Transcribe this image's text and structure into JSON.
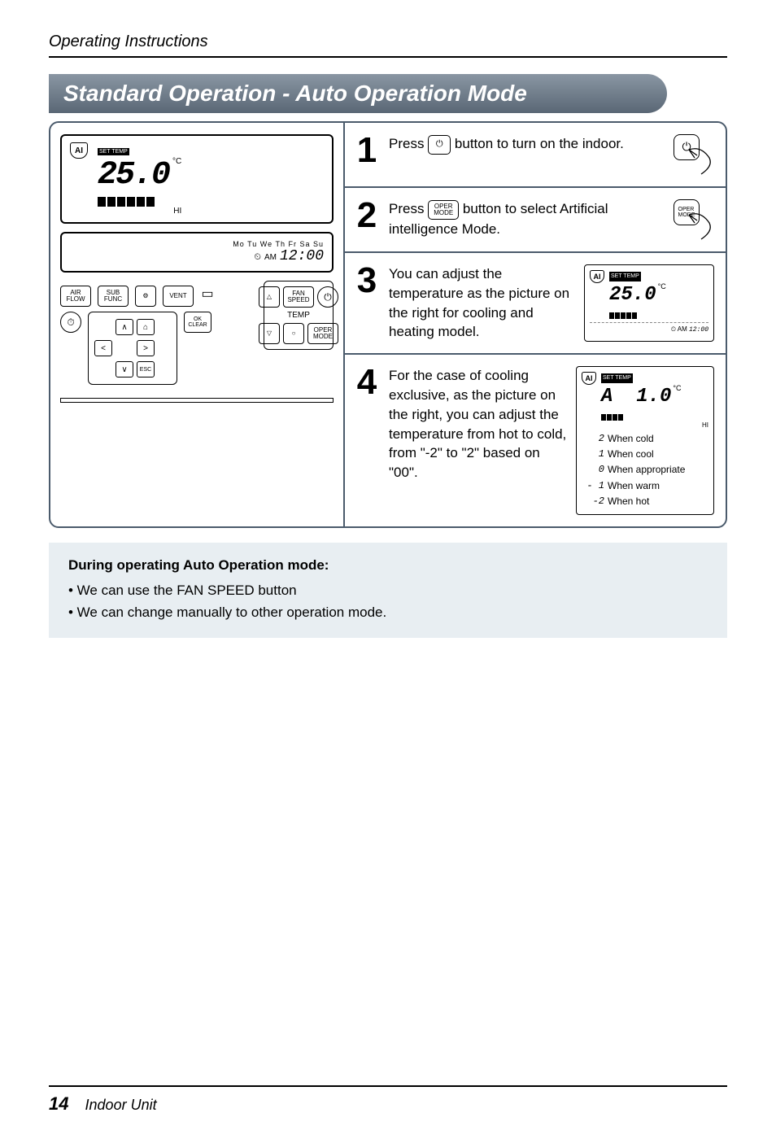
{
  "header": {
    "title": "Operating Instructions"
  },
  "section": {
    "title": "Standard Operation - Auto Operation Mode"
  },
  "remote": {
    "lcd1": {
      "set_temp_tag": "SET TEMP",
      "temp": "25.0",
      "unit": "°C",
      "ai": "AI",
      "hi": "HI"
    },
    "lcd2": {
      "days": "Mo Tu We Th Fr Sa Su",
      "am": "AM",
      "time": "12:00"
    },
    "buttons": {
      "air_flow": "AIR\nFLOW",
      "sub_func": "SUB\nFUNC",
      "settings": "⚙",
      "vent": "VENT",
      "timer": "⏱",
      "up": "∧",
      "home": "⌂",
      "ok_clear": "OK\nCLEAR",
      "left": "<",
      "right": ">",
      "down": "∨",
      "esc": "ESC",
      "tri_up": "△",
      "fan_speed": "FAN\nSPEED",
      "power": "⏻",
      "temp_lbl": "TEMP",
      "tri_down": "▽",
      "circle": "○",
      "oper_mode": "OPER\nMODE"
    }
  },
  "steps": [
    {
      "num": "1",
      "pre": "Press ",
      "btn_icon": "⏻",
      "post": " button to turn on the indoor.",
      "press_label": ""
    },
    {
      "num": "2",
      "pre": "Press ",
      "btn_text": "OPER\nMODE",
      "post": " button to select Artificial intelligence Mode.",
      "press_label": "OPER\nMODE"
    },
    {
      "num": "3",
      "text": "You can adjust the temperature as the picture on the right for cooling and heating model.",
      "mini": {
        "ai": "AI",
        "temp": "25.0",
        "unit": "°C",
        "time": "12:00",
        "am": "AM",
        "tag": "SET TEMP"
      }
    },
    {
      "num": "4",
      "text": "For the case of cooling exclusive, as the picture on the right, you can adjust the temperature from hot to cold, from \"-2\" to \"2\" based on \"00\".",
      "mini": {
        "ai": "AI",
        "disp": "A  1.0",
        "unit": "°C",
        "tag": "SET TEMP",
        "hi": "HI"
      },
      "legend": {
        "r1": {
          "sym": "2",
          "txt": "When cold"
        },
        "r2": {
          "sym": "1",
          "txt": "When cool"
        },
        "r3": {
          "sym": "0",
          "txt": "When appropriate"
        },
        "r4": {
          "sym": "- 1",
          "txt": "When warm"
        },
        "r5": {
          "sym": "-2",
          "txt": "When hot"
        }
      }
    }
  ],
  "note": {
    "heading": "During operating Auto Operation mode:",
    "b1": "• We can use the FAN SPEED button",
    "b2": "• We can change manually to other operation mode."
  },
  "footer": {
    "page": "14",
    "label": "Indoor Unit"
  }
}
